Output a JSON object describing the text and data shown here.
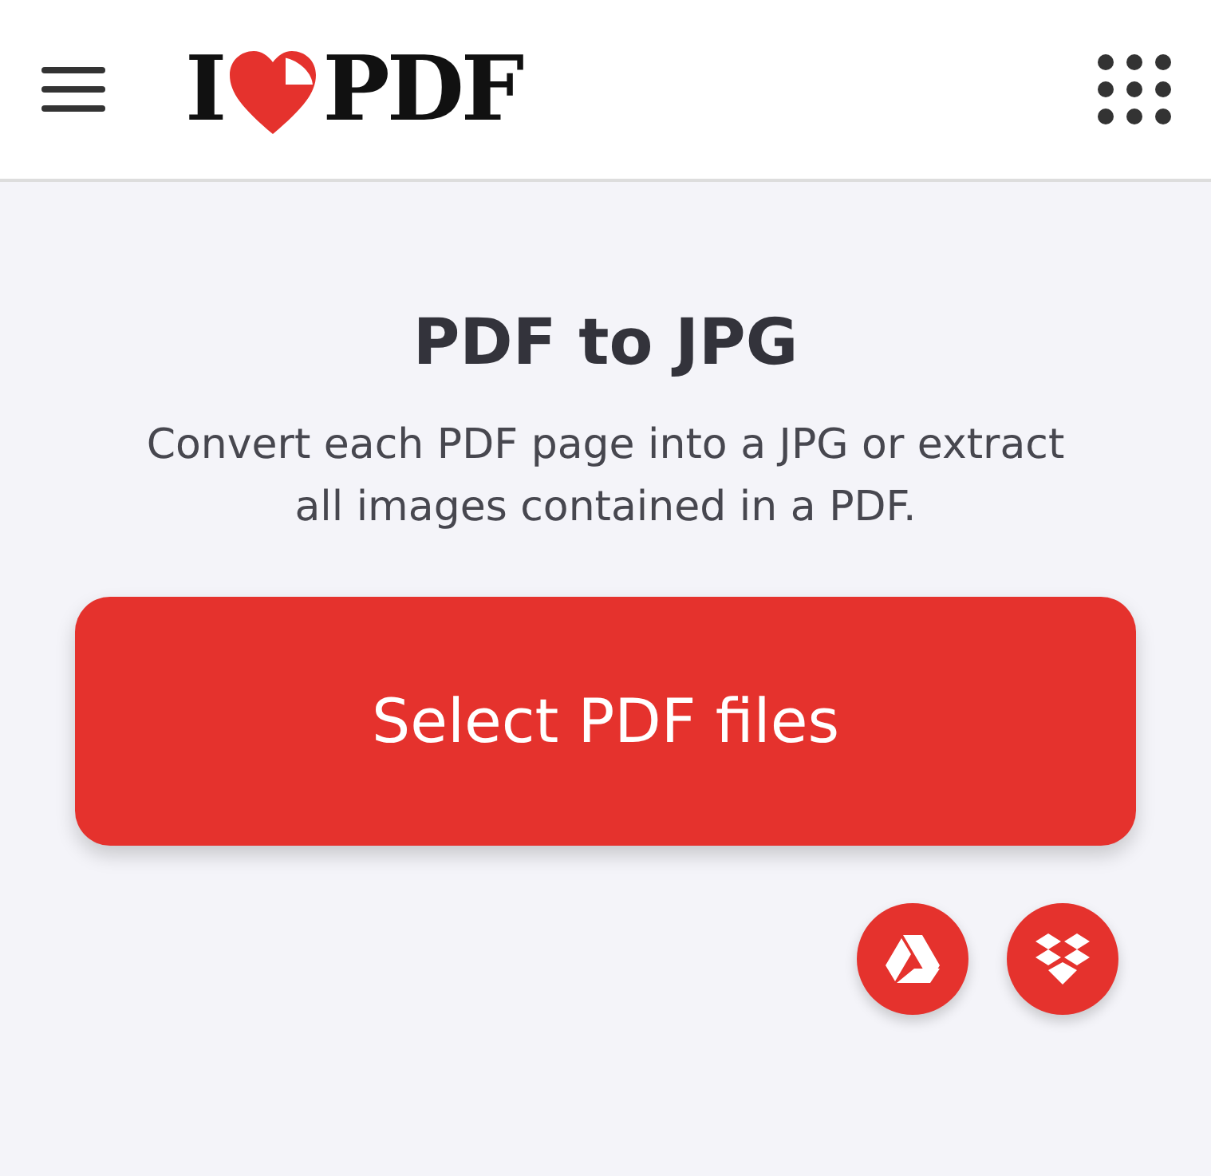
{
  "header": {
    "logo": {
      "before": "I",
      "after": "PDF"
    }
  },
  "title": "PDF to JPG",
  "description": "Convert each PDF page into a JPG or extract all images contained in a PDF.",
  "select_button": "Select PDF files"
}
